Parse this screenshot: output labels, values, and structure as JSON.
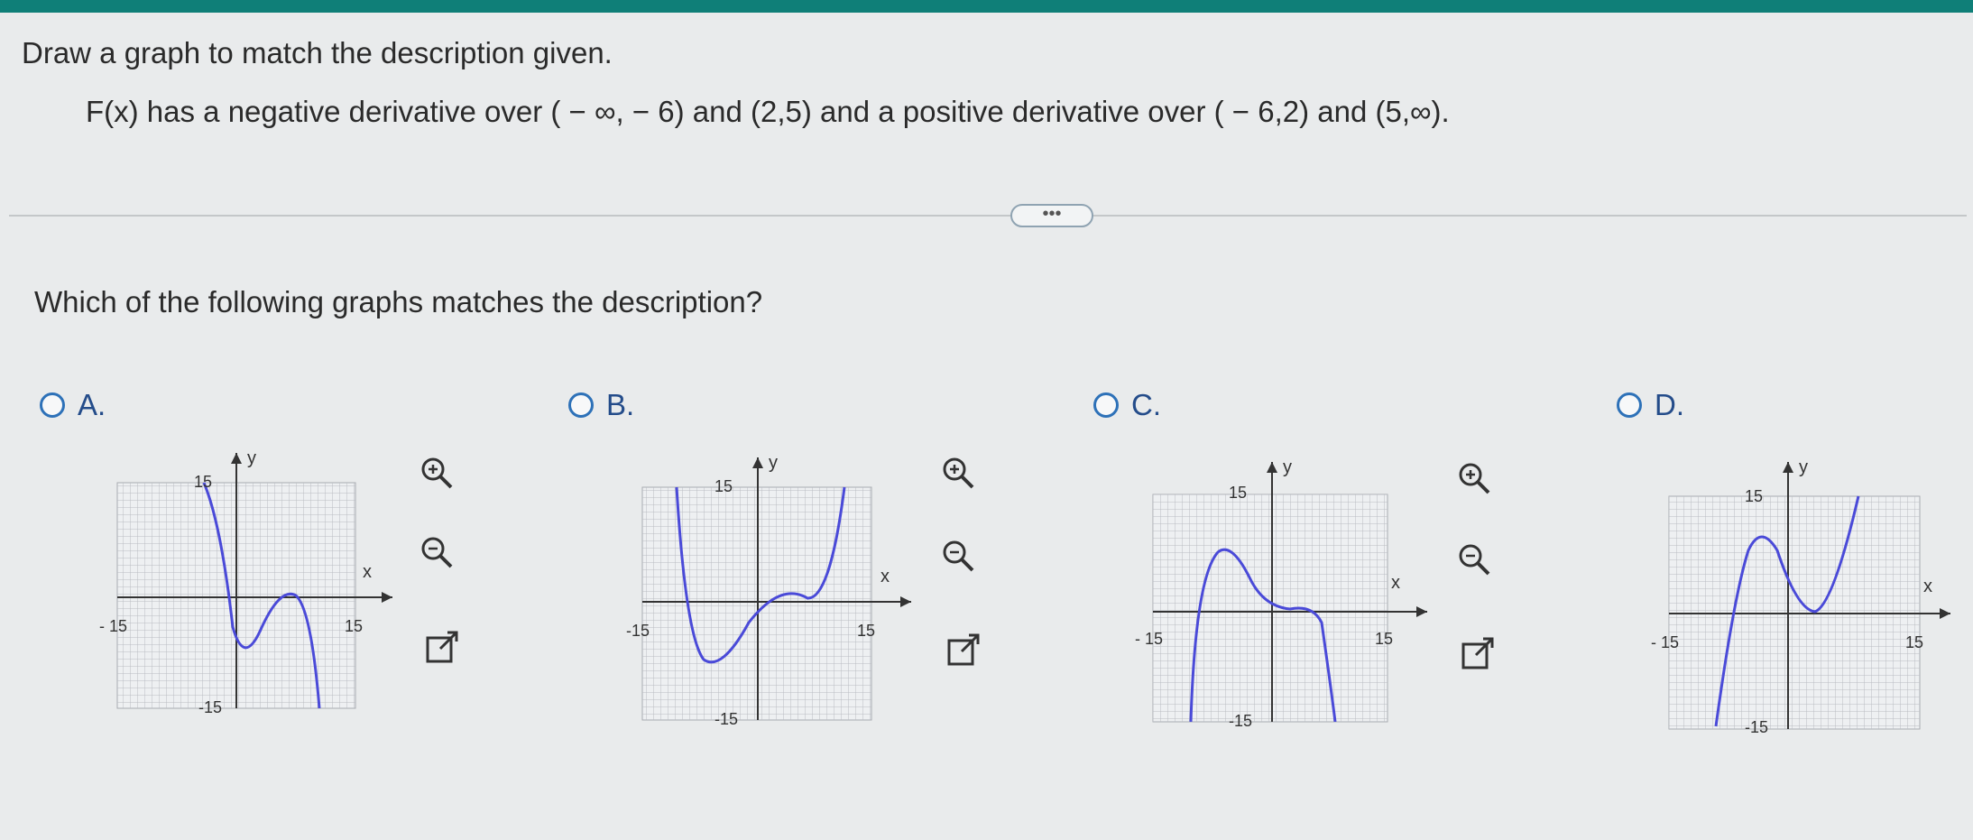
{
  "prompt": "Draw a graph to match the description given.",
  "description": "F(x) has a negative derivative over ( − ∞, − 6) and (2,5) and a positive derivative over ( − 6,2) and (5,∞).",
  "more_button": "•••",
  "question": "Which of the following graphs matches the description?",
  "options": [
    {
      "label": "A.",
      "axis": {
        "y": "y",
        "x": "x",
        "ymax": "15",
        "xmin": "- 15",
        "xmax": "15",
        "ymin": "-15"
      }
    },
    {
      "label": "B.",
      "axis": {
        "y": "y",
        "x": "x",
        "ymax": "15",
        "xmin": "-15",
        "xmax": "15",
        "ymin": "-15"
      }
    },
    {
      "label": "C.",
      "axis": {
        "y": "y",
        "x": "x",
        "ymax": "15",
        "xmin": "- 15",
        "xmax": "15",
        "ymin": "-15"
      }
    },
    {
      "label": "D.",
      "axis": {
        "y": "y",
        "x": "x",
        "ymax": "15",
        "xmin": "- 15",
        "xmax": "15",
        "ymin": "-15"
      }
    }
  ],
  "tools": [
    "zoom-in-icon",
    "zoom-out-icon",
    "popout-icon"
  ],
  "colors": {
    "topbar": "#0f7f78",
    "radio": "#2d71b8",
    "curve": "#4a4ad8",
    "grid": "#b9bcc2"
  }
}
